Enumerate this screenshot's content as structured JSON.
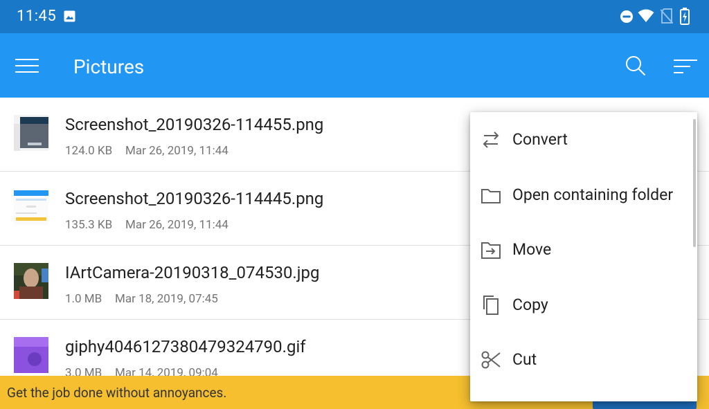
{
  "status_bar": {
    "time": "11:45",
    "icons": [
      "image-icon",
      "do-not-disturb-icon",
      "wifi-icon",
      "no-sim-icon",
      "battery-charging-icon"
    ]
  },
  "app_bar": {
    "title": "Pictures",
    "menu_icon": "hamburger-menu-icon",
    "search_icon": "search-icon",
    "sort_icon": "sort-icon"
  },
  "files": [
    {
      "name": "Screenshot_20190326-114455.png",
      "size": "124.0 KB",
      "date": "Mar 26, 2019, 11:44"
    },
    {
      "name": "Screenshot_20190326-114445.png",
      "size": "135.3 KB",
      "date": "Mar 26, 2019, 11:44"
    },
    {
      "name": "IArtCamera-20190318_074530.jpg",
      "size": "1.0 MB",
      "date": "Mar 18, 2019, 07:45"
    },
    {
      "name": "giphy4046127380479324790.gif",
      "size": "3.0 MB",
      "date": "Mar 14, 2019, 09:04"
    }
  ],
  "context_menu": {
    "items": [
      {
        "label": "Convert",
        "icon": "convert-arrows-icon"
      },
      {
        "label": "Open containing folder",
        "icon": "folder-icon"
      },
      {
        "label": "Move",
        "icon": "move-icon"
      },
      {
        "label": "Copy",
        "icon": "copy-icon"
      },
      {
        "label": "Cut",
        "icon": "scissors-icon"
      }
    ]
  },
  "promo": {
    "text": "Get the job done without annoyances."
  },
  "colors": {
    "status_bar": "#1a78c9",
    "app_bar": "#2196f3",
    "promo_banner": "#f5bf2f",
    "promo_button": "#1e6fbf"
  }
}
